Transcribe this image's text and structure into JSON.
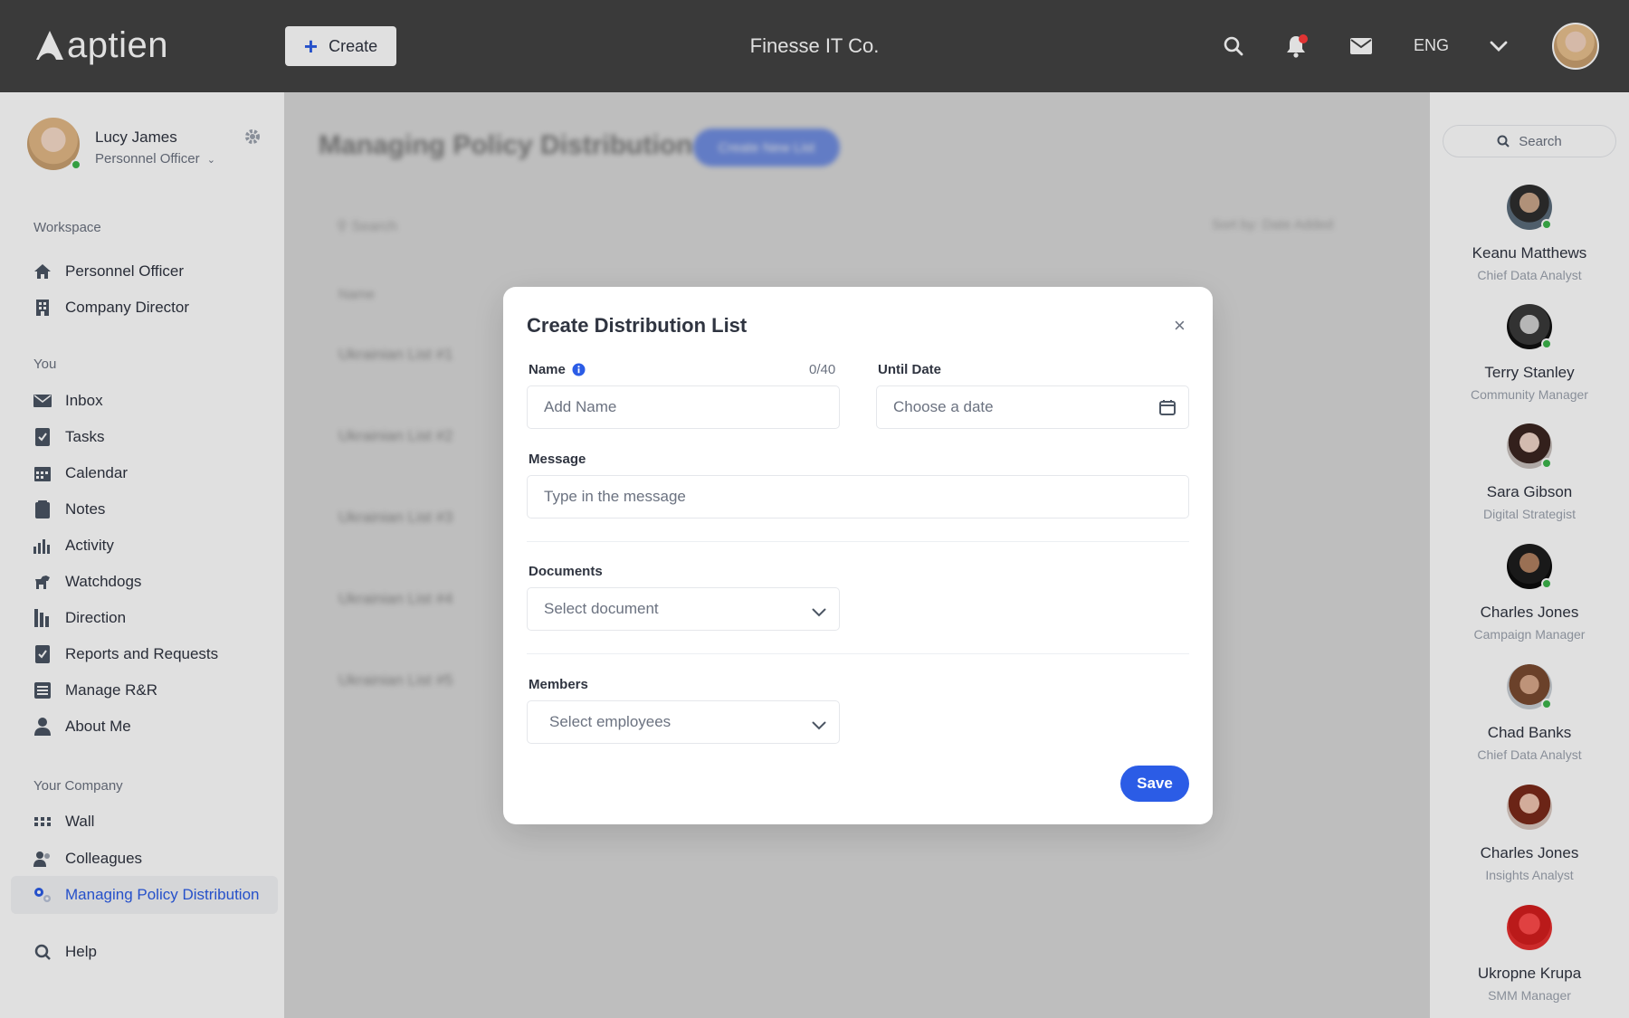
{
  "header": {
    "logo_text": "aptien",
    "create_label": "Create",
    "company": "Finesse IT Co.",
    "language": "ENG"
  },
  "profile": {
    "name": "Lucy James",
    "role": "Personnel Officer"
  },
  "sidebar": {
    "workspace_label": "Workspace",
    "workspace_items": [
      "Personnel Officer",
      "Company Director"
    ],
    "you_label": "You",
    "you_items": [
      "Inbox",
      "Tasks",
      "Calendar",
      "Notes",
      "Activity",
      "Watchdogs",
      "Direction",
      "Reports and Requests",
      "Manage R&R",
      "About Me"
    ],
    "company_label": "Your Company",
    "company_items": [
      "Wall",
      "Colleagues",
      "Managing Policy Distribution"
    ],
    "help_label": "Help"
  },
  "main": {
    "title": "Managing Policy Distribution",
    "create_new_list": "Create New List",
    "search_placeholder": "Search",
    "sort_label": "Sort by: Date Added",
    "column_name": "Name",
    "rows": [
      "Ukrainian List #1",
      "Ukrainian List #2",
      "Ukrainian List #3",
      "Ukrainian List #4",
      "Ukrainian List #5"
    ]
  },
  "right_panel": {
    "search_placeholder": "Search",
    "contacts": [
      {
        "name": "Keanu Matthews",
        "role": "Chief Data Analyst"
      },
      {
        "name": "Terry Stanley",
        "role": "Community Manager"
      },
      {
        "name": "Sara Gibson",
        "role": "Digital Strategist"
      },
      {
        "name": "Charles Jones",
        "role": "Campaign Manager"
      },
      {
        "name": "Chad Banks",
        "role": "Chief Data Analyst"
      },
      {
        "name": "Charles Jones",
        "role": "Insights Analyst"
      },
      {
        "name": "Ukropne Krupa",
        "role": "SMM Manager"
      }
    ]
  },
  "modal": {
    "title": "Create Distribution List",
    "name_label": "Name",
    "name_counter": "0/40",
    "name_placeholder": "Add Name",
    "until_label": "Until Date",
    "until_placeholder": "Choose a date",
    "message_label": "Message",
    "message_placeholder": "Type in the message",
    "documents_label": "Documents",
    "documents_placeholder": "Select document",
    "members_label": "Members",
    "members_placeholder": "Select employees",
    "save_label": "Save",
    "close_symbol": "×"
  },
  "colors": {
    "accent": "#2b5ce6",
    "topbar": "#434343",
    "online": "#3cb44b",
    "notification": "#ff3b3b"
  }
}
